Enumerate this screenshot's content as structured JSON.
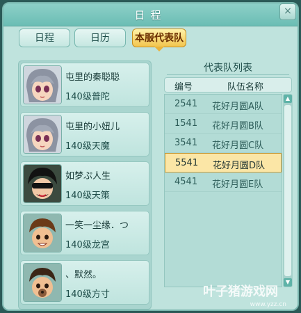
{
  "window": {
    "title": "日程",
    "close_label": "×"
  },
  "tabs": [
    {
      "label": "日程",
      "active": false
    },
    {
      "label": "日历",
      "active": false
    },
    {
      "label": "本服代表队",
      "active": true
    }
  ],
  "members": [
    {
      "name": "屯里的秦聪聪",
      "level": "140级普陀"
    },
    {
      "name": "屯里的小妞儿",
      "level": "140级天魔"
    },
    {
      "name": "如梦ぷ人生",
      "level": "140级天策"
    },
    {
      "name": "一笑一尘缘．つ",
      "level": "140级龙宫"
    },
    {
      "name": "、默然。",
      "level": "140级方寸"
    }
  ],
  "team_list": {
    "title": "代表队列表",
    "columns": [
      "编号",
      "队伍名称"
    ],
    "rows": [
      {
        "id": "2541",
        "name": "花好月圆A队",
        "selected": false
      },
      {
        "id": "1541",
        "name": "花好月圆B队",
        "selected": false
      },
      {
        "id": "3541",
        "name": "花好月圆C队",
        "selected": false
      },
      {
        "id": "5541",
        "name": "花好月圆D队",
        "selected": true
      },
      {
        "id": "4541",
        "name": "花好月圆E队",
        "selected": false
      }
    ]
  },
  "watermark": {
    "text": "叶子猪游戏网",
    "url": "www.yzz.cn"
  },
  "colors": {
    "accent": "#f2c54e",
    "panel": "#bfe3dd",
    "selected_row": "#fbe6a6"
  }
}
